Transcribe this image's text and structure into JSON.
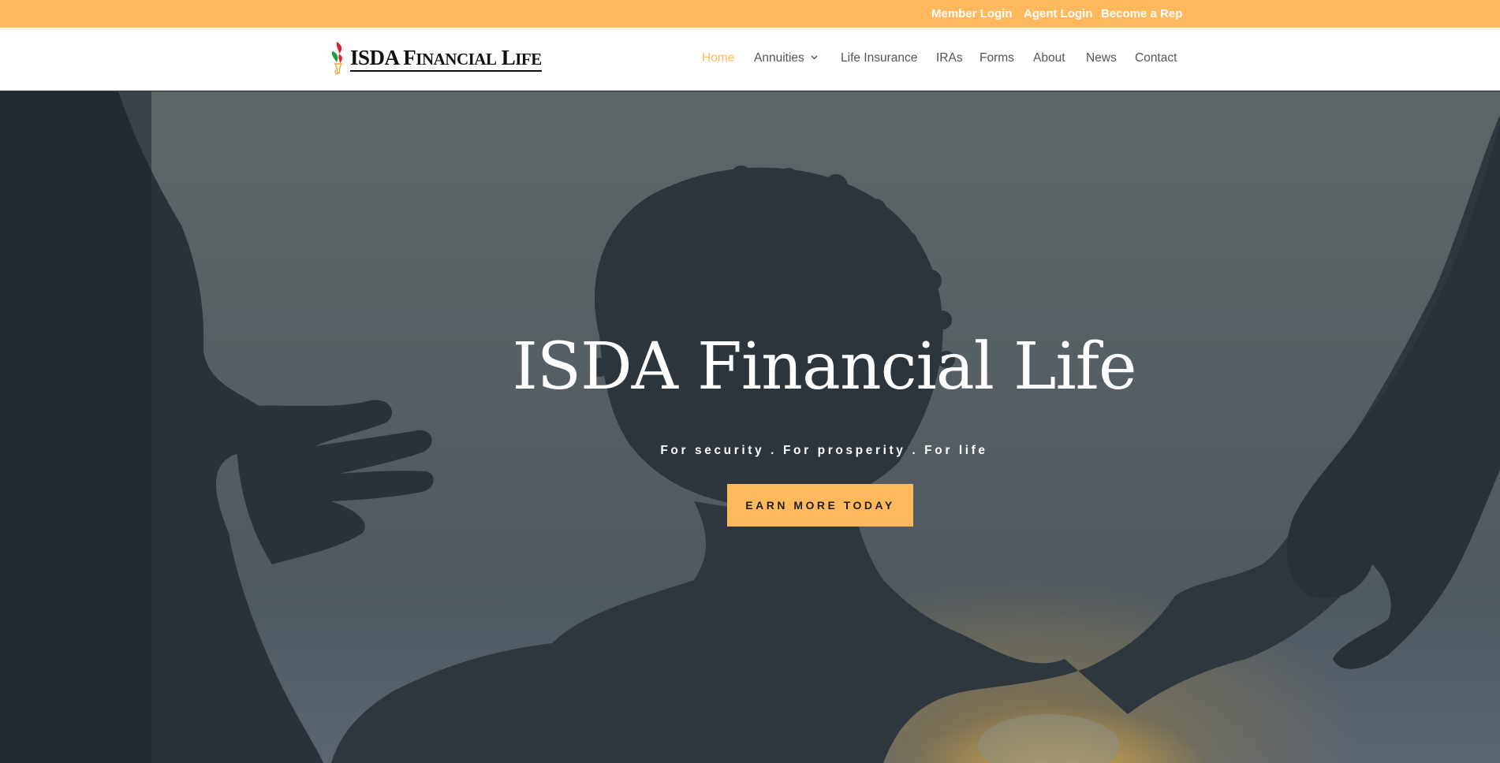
{
  "topbar": {
    "links": [
      "Member Login",
      "Agent Login",
      "Become a Rep"
    ]
  },
  "header": {
    "logo": {
      "text_main": "ISDA F",
      "text_sc1": "INANCIAL",
      "text_l": " L",
      "text_sc2": "IFE"
    },
    "nav": [
      {
        "label": "Home",
        "active": true
      },
      {
        "label": "Annuities",
        "has_dropdown": true
      },
      {
        "label": "Life Insurance"
      },
      {
        "label": "IRAs"
      },
      {
        "label": "Forms"
      },
      {
        "label": "About"
      },
      {
        "label": "News"
      },
      {
        "label": "Contact"
      }
    ]
  },
  "hero": {
    "title": "ISDA Financial Life",
    "subtitle": "For security . For prosperity . For life",
    "cta_label": "EARN MORE TODAY"
  },
  "colors": {
    "accent": "#ffb95c",
    "nav_text": "#555555",
    "hero_overlay": "#2b343c"
  },
  "icons": [
    "torch-logo-icon",
    "chevron-down-icon"
  ]
}
